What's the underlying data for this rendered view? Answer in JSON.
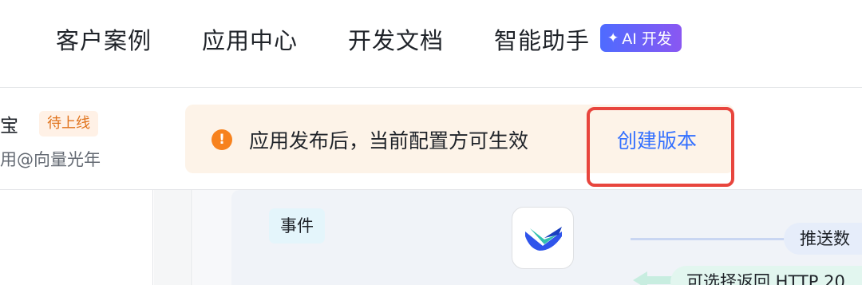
{
  "nav": {
    "items": [
      "客户案例",
      "应用中心",
      "开发文档",
      "智能助手"
    ],
    "ai_badge": "AI 开发"
  },
  "app": {
    "name": "宝",
    "status": "待上线",
    "owner": "用@向量光年"
  },
  "notice": {
    "text": "应用发布后，当前配置方可生效",
    "action": "创建版本"
  },
  "canvas": {
    "event_tag": "事件",
    "push_label": "推送数",
    "return_label": "可选择返回 HTTP 20"
  },
  "colors": {
    "accent": "#3370ff",
    "notice_bg": "#fdf3e8",
    "warning": "#f7821e",
    "highlight": "#e8453d"
  }
}
